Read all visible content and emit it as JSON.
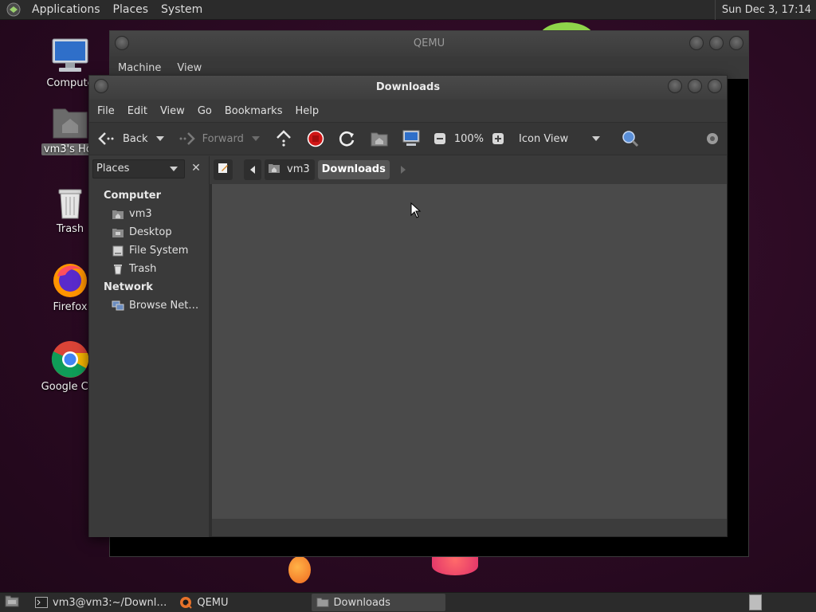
{
  "top_panel": {
    "menus": [
      "Applications",
      "Places",
      "System"
    ],
    "clock": "Sun Dec  3, 17:14"
  },
  "desktop": {
    "icons": [
      {
        "label": "Compute",
        "icon": "computer-icon"
      },
      {
        "label": "vm3's Hor",
        "icon": "home-folder-icon"
      },
      {
        "label": "Trash",
        "icon": "trash-icon"
      },
      {
        "label": "Firefox",
        "icon": "firefox-icon"
      },
      {
        "label": "Google Chr",
        "icon": "chrome-icon"
      }
    ]
  },
  "qemu_window": {
    "title": "QEMU",
    "menus": [
      "Machine",
      "View"
    ]
  },
  "files_window": {
    "title": "Downloads",
    "menus": [
      "File",
      "Edit",
      "View",
      "Go",
      "Bookmarks",
      "Help"
    ],
    "toolbar": {
      "back_label": "Back",
      "forward_label": "Forward",
      "zoom": "100%",
      "view_mode": "Icon View"
    },
    "sidebar": {
      "selector": "Places",
      "sections": [
        {
          "heading": "Computer",
          "items": [
            {
              "label": "vm3",
              "icon": "home-icon"
            },
            {
              "label": "Desktop",
              "icon": "desktop-folder-icon"
            },
            {
              "label": "File System",
              "icon": "filesystem-icon"
            },
            {
              "label": "Trash",
              "icon": "trash-icon"
            }
          ]
        },
        {
          "heading": "Network",
          "items": [
            {
              "label": "Browse Net…",
              "icon": "network-icon"
            }
          ]
        }
      ]
    },
    "path": {
      "crumbs": [
        "vm3",
        "Downloads"
      ],
      "active": "Downloads"
    }
  },
  "taskbar": {
    "tasks": [
      {
        "label": "vm3@vm3:~/Downl…",
        "icon": "terminal-icon"
      },
      {
        "label": "QEMU",
        "icon": "qemu-icon"
      },
      {
        "label": "Downloads",
        "icon": "folder-icon",
        "active": true
      }
    ]
  },
  "colors": {
    "desktop_bg": "#2a0a22",
    "panel_bg": "#2b2b2b",
    "window_bg": "#3a3a3a",
    "content_bg": "#4a4a4a",
    "stop_red": "#d01616"
  }
}
